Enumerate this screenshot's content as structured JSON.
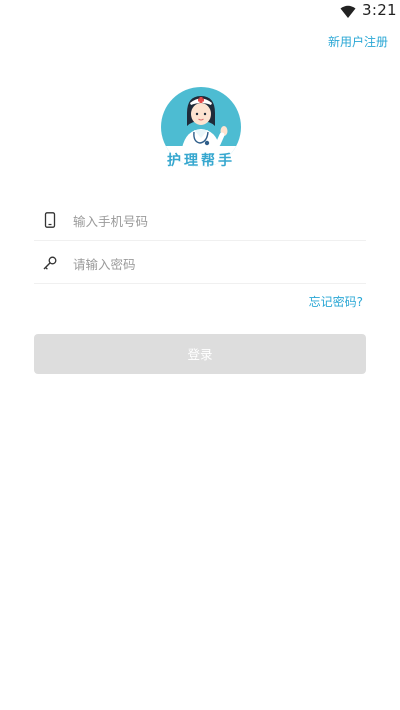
{
  "status_bar": {
    "time": "3:21",
    "wifi_icon": "wifi-icon"
  },
  "header": {
    "register_label": "新用户注册"
  },
  "logo": {
    "text": "护理帮手"
  },
  "form": {
    "phone": {
      "placeholder": "输入手机号码",
      "value": "",
      "icon": "phone-icon"
    },
    "password": {
      "placeholder": "请输入密码",
      "value": "",
      "icon": "key-icon"
    },
    "forgot_label": "忘记密码?",
    "login_label": "登录"
  },
  "colors": {
    "accent": "#2aa7d5",
    "logo_bg": "#4dbcd2",
    "button_disabled": "#dddddd"
  }
}
